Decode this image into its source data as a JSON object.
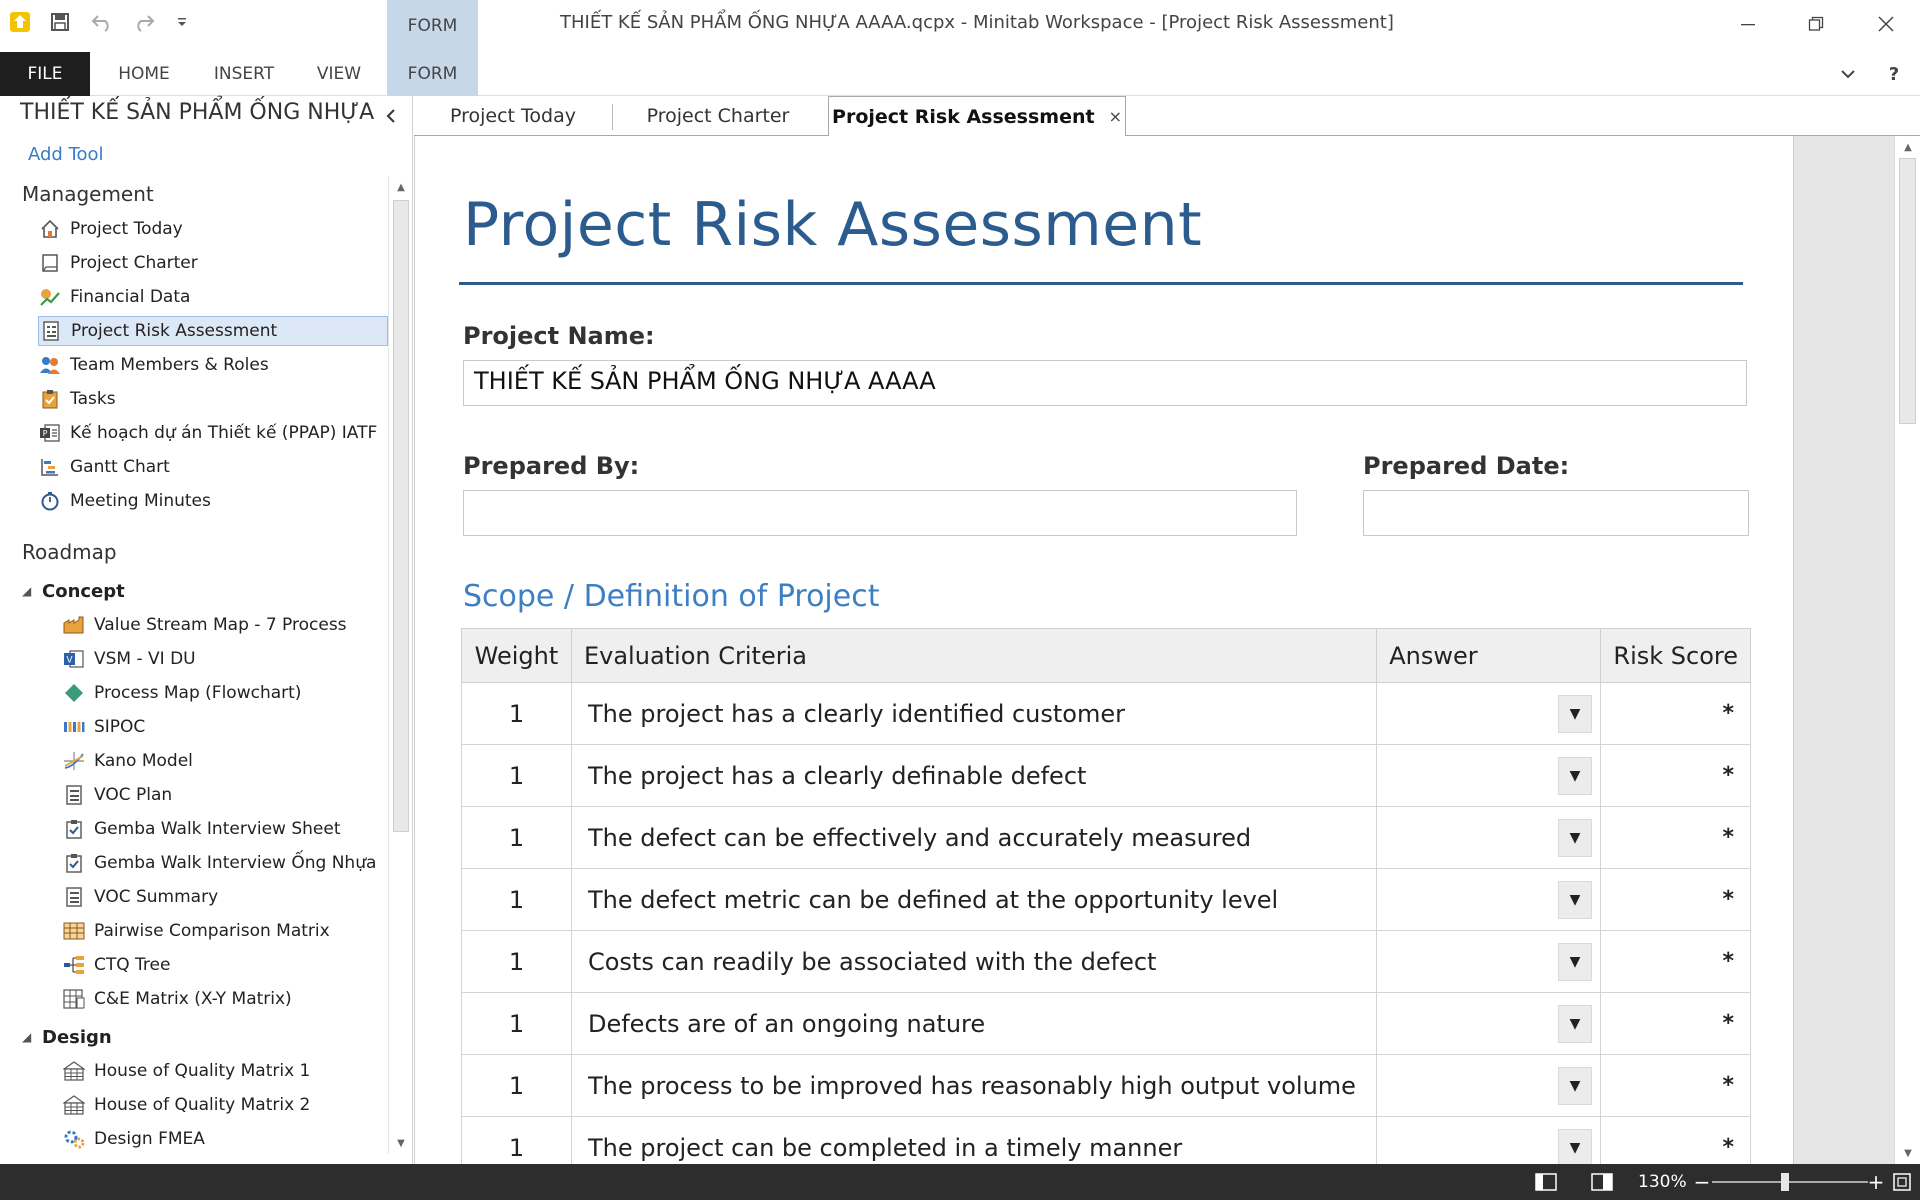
{
  "window": {
    "title": "THIẾT KẾ SẢN PHẨM ỐNG NHỰA AAAA.qcpx - Minitab Workspace - [Project Risk Assessment]",
    "context_tab": "FORM",
    "controls": [
      "minimize-icon",
      "restore-icon",
      "close-icon"
    ]
  },
  "quick_access": [
    "app-logo-icon",
    "save-icon",
    "undo-icon",
    "redo-icon",
    "customize-dropdown-icon"
  ],
  "ribbon": {
    "tabs": [
      "FILE",
      "HOME",
      "INSERT",
      "VIEW",
      "FORM"
    ],
    "help": "?"
  },
  "sidebar": {
    "project_title": "THIẾT KẾ SẢN PHẨM ỐNG NHỰA",
    "add_tool": "Add Tool",
    "management_heading": "Management",
    "management": [
      {
        "label": "Project Today",
        "icon": "home-icon"
      },
      {
        "label": "Project Charter",
        "icon": "charter-icon"
      },
      {
        "label": "Financial Data",
        "icon": "financial-icon"
      },
      {
        "label": "Project Risk Assessment",
        "icon": "form-icon",
        "selected": true
      },
      {
        "label": "Team Members & Roles",
        "icon": "team-icon"
      },
      {
        "label": "Tasks",
        "icon": "clipboard-icon"
      },
      {
        "label": "Kế hoạch dự án Thiết kế (PPAP) IATF",
        "icon": "project-plan-icon"
      },
      {
        "label": "Gantt Chart",
        "icon": "gantt-icon"
      },
      {
        "label": "Meeting Minutes",
        "icon": "stopwatch-icon"
      }
    ],
    "roadmap_heading": "Roadmap",
    "concept_heading": "Concept",
    "concept": [
      {
        "label": "Value Stream Map - 7 Process",
        "icon": "factory-icon"
      },
      {
        "label": "VSM - VI DU",
        "icon": "visio-icon"
      },
      {
        "label": "Process Map (Flowchart)",
        "icon": "diamond-icon"
      },
      {
        "label": "SIPOC",
        "icon": "sipoc-icon"
      },
      {
        "label": "Kano Model",
        "icon": "kano-icon"
      },
      {
        "label": "VOC Plan",
        "icon": "form-icon"
      },
      {
        "label": "Gemba Walk Interview Sheet",
        "icon": "checklist-icon"
      },
      {
        "label": "Gemba Walk Interview Ống Nhựa",
        "icon": "checklist-icon"
      },
      {
        "label": "VOC Summary",
        "icon": "form-icon"
      },
      {
        "label": "Pairwise Comparison Matrix",
        "icon": "matrix-icon"
      },
      {
        "label": "CTQ Tree",
        "icon": "tree-icon"
      },
      {
        "label": "C&E Matrix (X-Y Matrix)",
        "icon": "ce-matrix-icon"
      }
    ],
    "design_heading": "Design",
    "design": [
      {
        "label": "House of Quality Matrix 1",
        "icon": "house-of-quality-icon"
      },
      {
        "label": "House of Quality Matrix 2",
        "icon": "house-of-quality-icon"
      },
      {
        "label": "Design FMEA",
        "icon": "gears-icon"
      }
    ]
  },
  "doc_tabs": [
    {
      "label": "Project Today"
    },
    {
      "label": "Project Charter"
    },
    {
      "label": "Project Risk Assessment",
      "active": true,
      "close": "×"
    }
  ],
  "form": {
    "title": "Project Risk Assessment",
    "project_name_label": "Project Name:",
    "project_name_value": "THIẾT KẾ SẢN PHẨM ỐNG NHỰA AAAA",
    "prepared_by_label": "Prepared By:",
    "prepared_by_value": "",
    "prepared_date_label": "Prepared Date:",
    "prepared_date_value": "",
    "scope_heading": "Scope / Definition of Project",
    "table": {
      "headers": [
        "Weight",
        "Evaluation Criteria",
        "Answer",
        "Risk Score"
      ],
      "rows": [
        {
          "weight": "1",
          "criteria": "The project has a clearly identified customer",
          "answer": "",
          "score": "*"
        },
        {
          "weight": "1",
          "criteria": "The project has a clearly definable defect",
          "answer": "",
          "score": "*"
        },
        {
          "weight": "1",
          "criteria": "The defect can be effectively and accurately measured",
          "answer": "",
          "score": "*"
        },
        {
          "weight": "1",
          "criteria": "The defect metric can be defined at the opportunity level",
          "answer": "",
          "score": "*"
        },
        {
          "weight": "1",
          "criteria": "Costs can readily be associated with the defect",
          "answer": "",
          "score": "*"
        },
        {
          "weight": "1",
          "criteria": "Defects are of an ongoing nature",
          "answer": "",
          "score": "*"
        },
        {
          "weight": "1",
          "criteria": "The process to be improved has reasonably high output volume",
          "answer": "",
          "score": "*"
        },
        {
          "weight": "1",
          "criteria": "The project can be completed in a timely manner",
          "answer": "",
          "score": "*"
        }
      ]
    }
  },
  "statusbar": {
    "zoom_level": "130%",
    "zoom_minus": "−",
    "zoom_plus": "+",
    "zoom_fraction": 0.47
  },
  "colors": {
    "accent": "#2c5b8e",
    "link": "#3a7bc8",
    "selection": "#dde8f6",
    "context_tab": "#c6d7e9",
    "statusbar": "#2d2d2d"
  }
}
